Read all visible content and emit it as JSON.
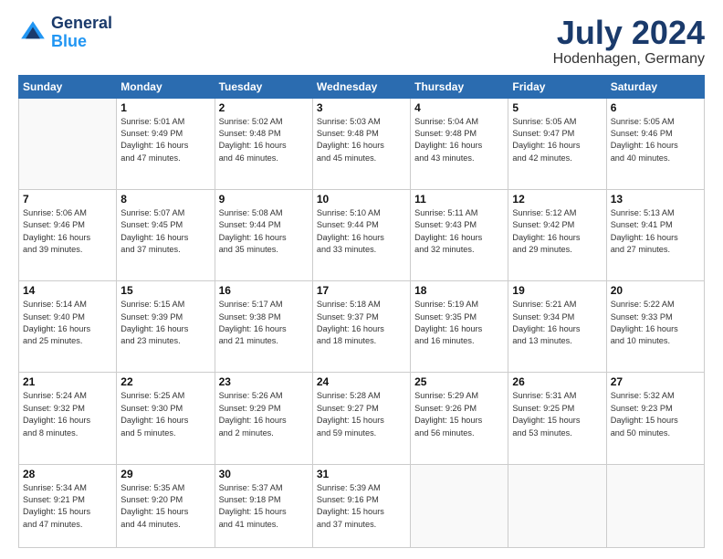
{
  "logo": {
    "line1": "General",
    "line2": "Blue"
  },
  "title": "July 2024",
  "subtitle": "Hodenhagen, Germany",
  "days_header": [
    "Sunday",
    "Monday",
    "Tuesday",
    "Wednesday",
    "Thursday",
    "Friday",
    "Saturday"
  ],
  "weeks": [
    [
      {
        "num": "",
        "info": ""
      },
      {
        "num": "1",
        "info": "Sunrise: 5:01 AM\nSunset: 9:49 PM\nDaylight: 16 hours\nand 47 minutes."
      },
      {
        "num": "2",
        "info": "Sunrise: 5:02 AM\nSunset: 9:48 PM\nDaylight: 16 hours\nand 46 minutes."
      },
      {
        "num": "3",
        "info": "Sunrise: 5:03 AM\nSunset: 9:48 PM\nDaylight: 16 hours\nand 45 minutes."
      },
      {
        "num": "4",
        "info": "Sunrise: 5:04 AM\nSunset: 9:48 PM\nDaylight: 16 hours\nand 43 minutes."
      },
      {
        "num": "5",
        "info": "Sunrise: 5:05 AM\nSunset: 9:47 PM\nDaylight: 16 hours\nand 42 minutes."
      },
      {
        "num": "6",
        "info": "Sunrise: 5:05 AM\nSunset: 9:46 PM\nDaylight: 16 hours\nand 40 minutes."
      }
    ],
    [
      {
        "num": "7",
        "info": "Sunrise: 5:06 AM\nSunset: 9:46 PM\nDaylight: 16 hours\nand 39 minutes."
      },
      {
        "num": "8",
        "info": "Sunrise: 5:07 AM\nSunset: 9:45 PM\nDaylight: 16 hours\nand 37 minutes."
      },
      {
        "num": "9",
        "info": "Sunrise: 5:08 AM\nSunset: 9:44 PM\nDaylight: 16 hours\nand 35 minutes."
      },
      {
        "num": "10",
        "info": "Sunrise: 5:10 AM\nSunset: 9:44 PM\nDaylight: 16 hours\nand 33 minutes."
      },
      {
        "num": "11",
        "info": "Sunrise: 5:11 AM\nSunset: 9:43 PM\nDaylight: 16 hours\nand 32 minutes."
      },
      {
        "num": "12",
        "info": "Sunrise: 5:12 AM\nSunset: 9:42 PM\nDaylight: 16 hours\nand 29 minutes."
      },
      {
        "num": "13",
        "info": "Sunrise: 5:13 AM\nSunset: 9:41 PM\nDaylight: 16 hours\nand 27 minutes."
      }
    ],
    [
      {
        "num": "14",
        "info": "Sunrise: 5:14 AM\nSunset: 9:40 PM\nDaylight: 16 hours\nand 25 minutes."
      },
      {
        "num": "15",
        "info": "Sunrise: 5:15 AM\nSunset: 9:39 PM\nDaylight: 16 hours\nand 23 minutes."
      },
      {
        "num": "16",
        "info": "Sunrise: 5:17 AM\nSunset: 9:38 PM\nDaylight: 16 hours\nand 21 minutes."
      },
      {
        "num": "17",
        "info": "Sunrise: 5:18 AM\nSunset: 9:37 PM\nDaylight: 16 hours\nand 18 minutes."
      },
      {
        "num": "18",
        "info": "Sunrise: 5:19 AM\nSunset: 9:35 PM\nDaylight: 16 hours\nand 16 minutes."
      },
      {
        "num": "19",
        "info": "Sunrise: 5:21 AM\nSunset: 9:34 PM\nDaylight: 16 hours\nand 13 minutes."
      },
      {
        "num": "20",
        "info": "Sunrise: 5:22 AM\nSunset: 9:33 PM\nDaylight: 16 hours\nand 10 minutes."
      }
    ],
    [
      {
        "num": "21",
        "info": "Sunrise: 5:24 AM\nSunset: 9:32 PM\nDaylight: 16 hours\nand 8 minutes."
      },
      {
        "num": "22",
        "info": "Sunrise: 5:25 AM\nSunset: 9:30 PM\nDaylight: 16 hours\nand 5 minutes."
      },
      {
        "num": "23",
        "info": "Sunrise: 5:26 AM\nSunset: 9:29 PM\nDaylight: 16 hours\nand 2 minutes."
      },
      {
        "num": "24",
        "info": "Sunrise: 5:28 AM\nSunset: 9:27 PM\nDaylight: 15 hours\nand 59 minutes."
      },
      {
        "num": "25",
        "info": "Sunrise: 5:29 AM\nSunset: 9:26 PM\nDaylight: 15 hours\nand 56 minutes."
      },
      {
        "num": "26",
        "info": "Sunrise: 5:31 AM\nSunset: 9:25 PM\nDaylight: 15 hours\nand 53 minutes."
      },
      {
        "num": "27",
        "info": "Sunrise: 5:32 AM\nSunset: 9:23 PM\nDaylight: 15 hours\nand 50 minutes."
      }
    ],
    [
      {
        "num": "28",
        "info": "Sunrise: 5:34 AM\nSunset: 9:21 PM\nDaylight: 15 hours\nand 47 minutes."
      },
      {
        "num": "29",
        "info": "Sunrise: 5:35 AM\nSunset: 9:20 PM\nDaylight: 15 hours\nand 44 minutes."
      },
      {
        "num": "30",
        "info": "Sunrise: 5:37 AM\nSunset: 9:18 PM\nDaylight: 15 hours\nand 41 minutes."
      },
      {
        "num": "31",
        "info": "Sunrise: 5:39 AM\nSunset: 9:16 PM\nDaylight: 15 hours\nand 37 minutes."
      },
      {
        "num": "",
        "info": ""
      },
      {
        "num": "",
        "info": ""
      },
      {
        "num": "",
        "info": ""
      }
    ]
  ]
}
